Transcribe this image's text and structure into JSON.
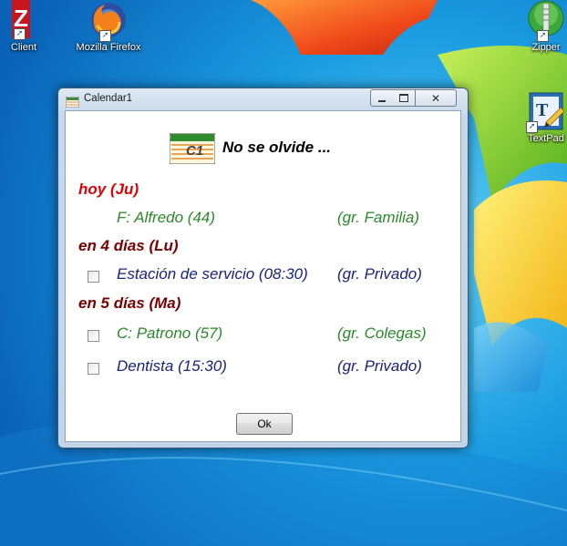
{
  "desktop": {
    "icons": [
      {
        "label": "Client"
      },
      {
        "label": "Mozilla Firefox"
      },
      {
        "label": "Zipper"
      },
      {
        "label": "TextPad"
      }
    ]
  },
  "window": {
    "title": "Calendar1",
    "heading": "No se olvide ...",
    "sections": [
      {
        "label": "hoy (Ju)",
        "color": "#e00000",
        "entries": [
          {
            "text": "F: Alfredo (44)",
            "group": "(gr. Familia)",
            "color": "#2a8a2a",
            "checkbox": false
          }
        ]
      },
      {
        "label": "en 4 días (Lu)",
        "color": "#7a0000",
        "entries": [
          {
            "text": "Estación de servicio (08:30)",
            "group": "(gr. Privado)",
            "color": "#1a237e",
            "checkbox": true
          }
        ]
      },
      {
        "label": "en 5 días (Ma)",
        "color": "#7a0000",
        "entries": [
          {
            "text": "C: Patrono (57)",
            "group": "(gr. Colegas)",
            "color": "#2a8a2a",
            "checkbox": true
          },
          {
            "text": "Dentista (15:30)",
            "group": "(gr. Privado)",
            "color": "#1a237e",
            "checkbox": true
          }
        ]
      }
    ],
    "ok_label": "Ok"
  }
}
